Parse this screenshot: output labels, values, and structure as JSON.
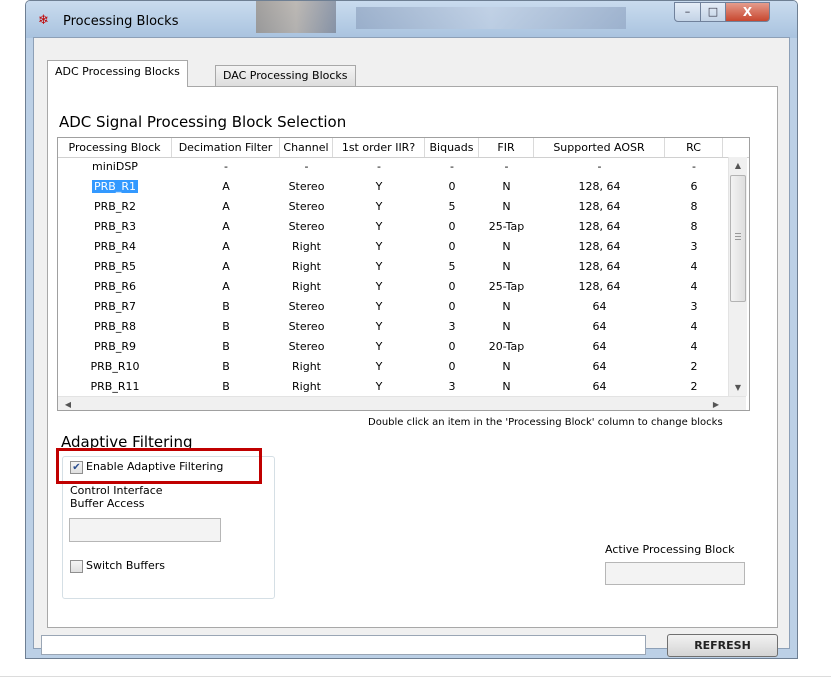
{
  "window": {
    "title": "Processing Blocks",
    "minimize": "–",
    "maximize": "□",
    "close": "X"
  },
  "tabs": [
    {
      "label": "ADC Processing Blocks",
      "active": true
    },
    {
      "label": "DAC Processing Blocks",
      "active": false
    }
  ],
  "adc_section": {
    "title": "ADC Signal Processing Block Selection",
    "columns": [
      "Processing Block",
      "Decimation Filter",
      "Channel",
      "1st order IIR?",
      "Biquads",
      "FIR",
      "Supported AOSR",
      "RC"
    ],
    "rows": [
      [
        "miniDSP",
        "-",
        "-",
        "-",
        "-",
        "-",
        "-",
        "-"
      ],
      [
        "PRB_R1",
        "A",
        "Stereo",
        "Y",
        "0",
        "N",
        "128, 64",
        "6"
      ],
      [
        "PRB_R2",
        "A",
        "Stereo",
        "Y",
        "5",
        "N",
        "128, 64",
        "8"
      ],
      [
        "PRB_R3",
        "A",
        "Stereo",
        "Y",
        "0",
        "25-Tap",
        "128, 64",
        "8"
      ],
      [
        "PRB_R4",
        "A",
        "Right",
        "Y",
        "0",
        "N",
        "128, 64",
        "3"
      ],
      [
        "PRB_R5",
        "A",
        "Right",
        "Y",
        "5",
        "N",
        "128, 64",
        "4"
      ],
      [
        "PRB_R6",
        "A",
        "Right",
        "Y",
        "0",
        "25-Tap",
        "128, 64",
        "4"
      ],
      [
        "PRB_R7",
        "B",
        "Stereo",
        "Y",
        "0",
        "N",
        "64",
        "3"
      ],
      [
        "PRB_R8",
        "B",
        "Stereo",
        "Y",
        "3",
        "N",
        "64",
        "4"
      ],
      [
        "PRB_R9",
        "B",
        "Stereo",
        "Y",
        "0",
        "20-Tap",
        "64",
        "4"
      ],
      [
        "PRB_R10",
        "B",
        "Right",
        "Y",
        "0",
        "N",
        "64",
        "2"
      ],
      [
        "PRB_R11",
        "B",
        "Right",
        "Y",
        "3",
        "N",
        "64",
        "2"
      ]
    ],
    "selected_row": 1,
    "hint": "Double click an item in the 'Processing Block' column to change blocks"
  },
  "adaptive": {
    "title": "Adaptive Filtering",
    "enable_label": "Enable Adaptive Filtering",
    "enable_checked": true,
    "buffer_access_label": "Control Interface\nBuffer Access",
    "buffer_access_line1": "Control Interface",
    "buffer_access_line2": "Buffer Access",
    "buffer_access_value": "",
    "switch_buffers_label": "Switch Buffers",
    "switch_buffers_checked": false
  },
  "active_block": {
    "label": "Active Processing Block",
    "value": ""
  },
  "status": {
    "text": ""
  },
  "refresh_label": "REFRESH",
  "colors": {
    "selection": "#3399ff",
    "highlight_box": "#c00000",
    "close_button": "#c8472f"
  },
  "icons": {
    "app": "ti-logo-icon",
    "scroll_up": "triangle-up",
    "scroll_down": "triangle-down",
    "scroll_left": "triangle-left",
    "scroll_right": "triangle-right",
    "check": "check-mark"
  }
}
